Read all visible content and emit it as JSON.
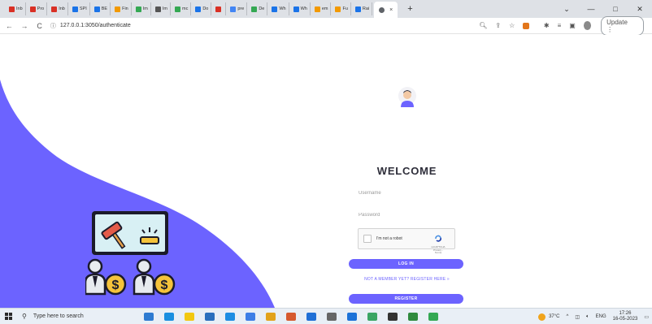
{
  "browser": {
    "tabs": [
      {
        "label": "Inb",
        "color": "#d93025"
      },
      {
        "label": "Pro",
        "color": "#d93025"
      },
      {
        "label": "Inb",
        "color": "#d93025"
      },
      {
        "label": "SPI",
        "color": "#1a73e8"
      },
      {
        "label": "BE",
        "color": "#1a73e8"
      },
      {
        "label": "Fin",
        "color": "#f29900"
      },
      {
        "label": "Im",
        "color": "#34a853"
      },
      {
        "label": "Im",
        "color": "#555555"
      },
      {
        "label": "mc",
        "color": "#34a853"
      },
      {
        "label": "Do",
        "color": "#1a73e8"
      },
      {
        "label": "",
        "color": "#d93025"
      },
      {
        "label": "pre",
        "color": "#4285f4"
      },
      {
        "label": "De",
        "color": "#34a853"
      },
      {
        "label": "Wh",
        "color": "#1a73e8"
      },
      {
        "label": "Wh",
        "color": "#1a73e8"
      },
      {
        "label": "em",
        "color": "#f29900"
      },
      {
        "label": "Fu",
        "color": "#f29900"
      },
      {
        "label": "Rai",
        "color": "#1a73e8"
      }
    ],
    "new_tab_symbol": "+",
    "close_tab_symbol": "×",
    "url": "127.0.0.1:3050/authenticate",
    "update_label": "Update",
    "window_controls": {
      "minimize": "—",
      "maximize": "□",
      "close": "✕"
    }
  },
  "login": {
    "title": "WELCOME",
    "username_placeholder": "Username",
    "password_placeholder": "Password",
    "captcha_label": "I'm not a robot",
    "captcha_brand": "reCAPTCHA",
    "captcha_terms": "Privacy - Terms",
    "login_button": "LOG IN",
    "register_link": "NOT A MEMBER YET? REGISTER HERE »",
    "register_button": "REGISTER"
  },
  "colors": {
    "accent": "#6c63ff",
    "accent_dark": "#5b55f0"
  },
  "taskbar": {
    "search_placeholder": "Type here to search",
    "weather": "37°C",
    "language": "ENG",
    "time": "17:26",
    "date": "16-05-2023",
    "apps": [
      "#2e7bd1",
      "#1a8fe0",
      "#f2c811",
      "#2a6fbd",
      "#1c8de3",
      "#3d7ee6",
      "#e2a21b",
      "#d65a2f",
      "#1f6fd6",
      "#666666",
      "#1c72d8",
      "#3aa564",
      "#333333",
      "#2f8a3e",
      "#34a853"
    ]
  }
}
